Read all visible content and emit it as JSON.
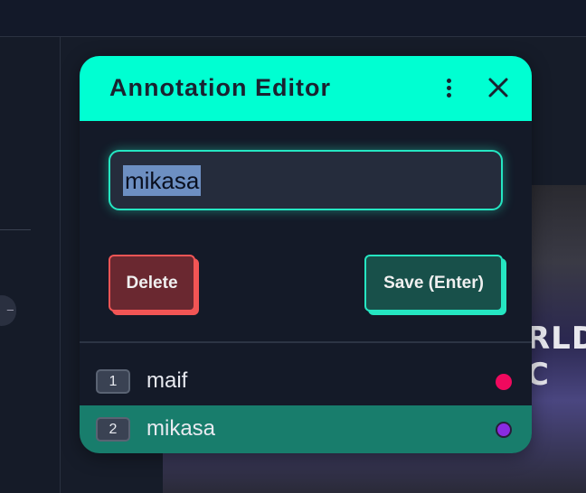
{
  "editor": {
    "title": "Annotation Editor",
    "name_value": "mikasa",
    "delete_label": "Delete",
    "save_label": "Save (Enter)",
    "icons": [
      "more-vertical-icon",
      "close-icon"
    ]
  },
  "annotations": [
    {
      "number": "1",
      "name": "maif",
      "color": "#f0095e",
      "selected": false
    },
    {
      "number": "2",
      "name": "mikasa",
      "color": "#8a2be2",
      "selected": true
    }
  ],
  "colors": {
    "accent": "#00ffd2",
    "danger": "#f25555",
    "panel_bg": "#141a28",
    "selected_row": "#187d6c"
  },
  "background": {
    "video_text": "RLD C"
  }
}
